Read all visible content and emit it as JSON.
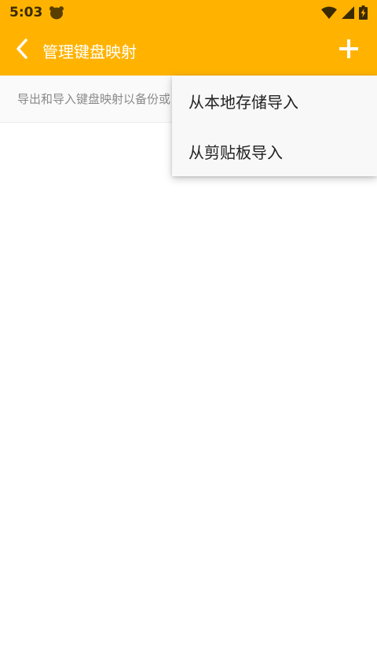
{
  "status_bar": {
    "time": "5:03",
    "icons": [
      "bear-icon",
      "wifi-icon",
      "signal-icon",
      "battery-charging-icon"
    ]
  },
  "app_bar": {
    "title": "管理键盘映射",
    "back_icon": "back-chevron-icon",
    "add_icon": "plus-icon",
    "color": "#FFB300"
  },
  "description": {
    "text": "导出和导入键盘映射以备份或"
  },
  "menu": {
    "items": [
      {
        "label": "从本地存储导入"
      },
      {
        "label": "从剪贴板导入"
      }
    ]
  }
}
